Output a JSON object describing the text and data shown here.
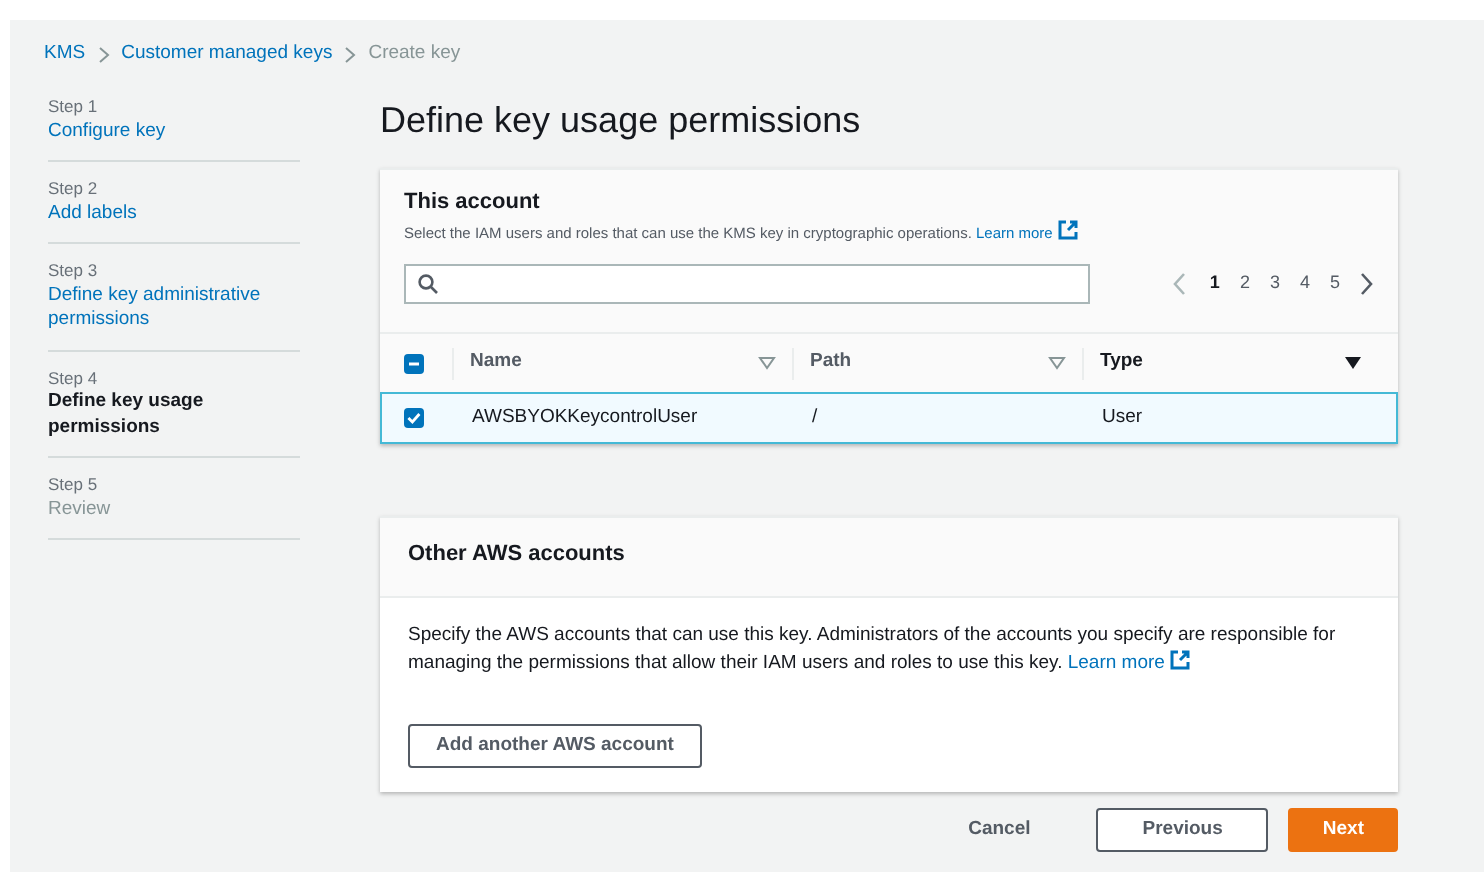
{
  "breadcrumbs": [
    {
      "label": "KMS",
      "link": true
    },
    {
      "label": "Customer managed keys",
      "link": true
    },
    {
      "label": "Create key",
      "link": false
    }
  ],
  "steps": [
    {
      "step": "Step 1",
      "title": "Configure key",
      "selected": false,
      "disabled": false
    },
    {
      "step": "Step 2",
      "title": "Add labels",
      "selected": false,
      "disabled": false
    },
    {
      "step": "Step 3",
      "title": "Define key administrative permissions",
      "selected": false,
      "disabled": false
    },
    {
      "step": "Step 4",
      "title": "Define key usage permissions",
      "selected": true,
      "disabled": false
    },
    {
      "step": "Step 5",
      "title": "Review",
      "selected": false,
      "disabled": true
    }
  ],
  "title": "Define key usage permissions",
  "this_account": {
    "heading": "This account",
    "description": "Select the IAM users and roles that can use the KMS key in cryptographic operations.",
    "learn_more": "Learn more",
    "pages": [
      {
        "label": "1",
        "selected": true
      },
      {
        "label": "2",
        "selected": false
      },
      {
        "label": "3",
        "selected": false
      },
      {
        "label": "4",
        "selected": false
      },
      {
        "label": "5",
        "selected": false
      }
    ],
    "select_all": {
      "indeterminate": true
    },
    "columns": [
      {
        "label": "Name",
        "sorted": false
      },
      {
        "label": "Path",
        "sorted": false
      },
      {
        "label": "Type",
        "sorted": true
      }
    ],
    "rows": [
      {
        "cells": [
          "AWSBYOKKeycontrolUser",
          "/",
          "User"
        ],
        "checked": true,
        "selected": true
      }
    ]
  },
  "other_accounts": {
    "heading": "Other AWS accounts",
    "description": "Specify the AWS accounts that can use this key. Administrators of the accounts you specify are responsible for managing the permissions that allow their IAM users and roles to use this key.",
    "learn_more": "Learn more",
    "add_button": "Add another AWS account"
  },
  "buttons": [
    {
      "label": "Cancel",
      "kind": "link"
    },
    {
      "label": "Previous",
      "kind": "secondary"
    },
    {
      "label": "Next",
      "kind": "primary"
    }
  ]
}
